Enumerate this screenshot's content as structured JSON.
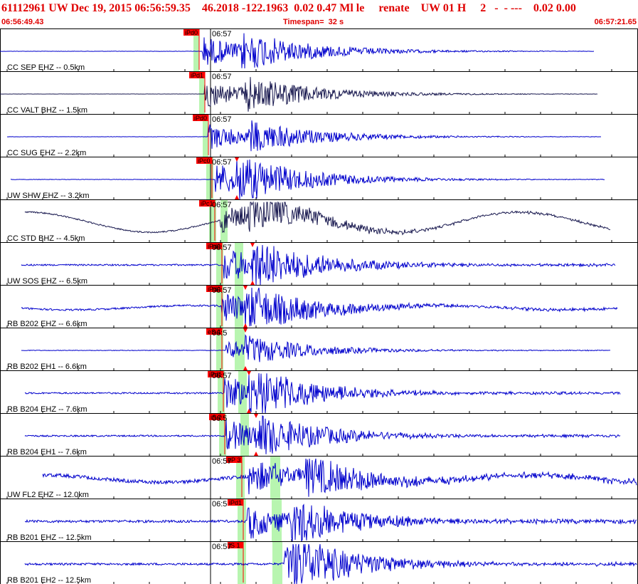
{
  "header": {
    "title": "61112961 UW Dec 19, 2015 06:56:59.35    46.2018 -122.1963  0.02 0.47 Ml le     renate    UW 01 H     2   -  - ---    0.02 0.00",
    "start_time": "06:56:49.43",
    "timespan": "Timespan=  32 s",
    "end_time": "06:57:21.65"
  },
  "colors": {
    "accent": "#e00000",
    "trace_blue": "#0000cc",
    "trace_dark": "#1a1a50",
    "pick_window": "#b8f5b0",
    "pick_flag": "#ff0000"
  },
  "traces": [
    {
      "label": "CC SEP EHZ -- 0.5km",
      "time_label": "06:57",
      "pick_label": "iPd0",
      "color": "blue",
      "noise": 0.4,
      "drift": 0,
      "onset": 285,
      "s_onset": 340,
      "end": 835,
      "amp": 22,
      "start": 0
    },
    {
      "label": "CC VALT BHZ -- 1.5km",
      "time_label": "06:57",
      "pick_label": "iPd1",
      "color": "dark",
      "noise": 0.3,
      "drift": 0,
      "onset": 288,
      "s_onset": 345,
      "end": 840,
      "amp": 20,
      "start": 0
    },
    {
      "label": "CC SUG EHZ -- 2.2km",
      "time_label": "06:57",
      "pick_label": "iPd0",
      "color": "blue",
      "noise": 0.4,
      "drift": 0,
      "onset": 293,
      "s_onset": 350,
      "end": 845,
      "amp": 18,
      "start": 10
    },
    {
      "label": "UW SHW EHZ -- 3.2km",
      "time_label": "06:57",
      "pick_label": "iPc0",
      "color": "blue",
      "noise": 0.6,
      "drift": 0,
      "onset": 303,
      "s_onset": 333,
      "end": 850,
      "amp": 24,
      "start": 15
    },
    {
      "label": "CC STD BHZ -- 4.5km",
      "time_label": "06:57",
      "pick_label": "iPc1",
      "color": "dark",
      "noise": 2.0,
      "drift": 14,
      "onset": 310,
      "s_onset": 350,
      "end": 858,
      "amp": 20,
      "start": 35
    },
    {
      "label": "UW SOS EHZ -- 6.5km",
      "time_label": "06:57",
      "pick_label": "iPd0",
      "color": "blue",
      "noise": 2.2,
      "drift": 0,
      "onset": 315,
      "s_onset": 355,
      "end": 865,
      "amp": 26,
      "start": 30
    },
    {
      "label": "RB B202 EHZ -- 6.6km",
      "time_label": "06:57",
      "pick_label": "iPd0",
      "color": "blue",
      "noise": 2.5,
      "drift": 3,
      "onset": 312,
      "s_onset": 345,
      "end": 868,
      "amp": 24,
      "start": 30
    },
    {
      "label": "RB B202 EH1 -- 6.6km",
      "time_label": "06:5",
      "pick_label": "eS 1",
      "color": "blue",
      "noise": 0.8,
      "drift": 0,
      "onset": 318,
      "s_onset": 345,
      "end": 858,
      "amp": 14,
      "start": 30
    },
    {
      "label": "RB B204 EHZ -- 7.6km",
      "time_label": "06:57",
      "pick_label": "iPd1",
      "color": "blue",
      "noise": 2.2,
      "drift": 0,
      "onset": 316,
      "s_onset": 350,
      "end": 872,
      "amp": 26,
      "start": 35
    },
    {
      "label": "RB B204 EH1 -- 7.6km",
      "time_label": "06:5",
      "pick_label": "iS 2",
      "color": "blue",
      "noise": 2.2,
      "drift": 0,
      "onset": 318,
      "s_onset": 360,
      "end": 872,
      "amp": 24,
      "start": 35
    },
    {
      "label": "UW FL2 EHZ -- 12.0km",
      "time_label": "06:57",
      "pick_label": "eP 3",
      "color": "blue",
      "noise": 5.0,
      "drift": 5,
      "onset": 350,
      "s_onset": 430,
      "end": 895,
      "amp": 26,
      "start": 60
    },
    {
      "label": "RB B201 EHZ -- 12.5km",
      "time_label": "06:5",
      "pick_label": "iPd1",
      "color": "blue",
      "noise": 3.5,
      "drift": 0,
      "onset": 348,
      "s_onset": 410,
      "end": 895,
      "amp": 26,
      "start": 35
    },
    {
      "label": "RB B201 EH2 -- 12.5km",
      "time_label": "06:57",
      "pick_label": "iS 1",
      "color": "blue",
      "noise": 3.0,
      "drift": 0,
      "onset": 400,
      "s_onset": 410,
      "end": 895,
      "amp": 26,
      "start": 35
    }
  ]
}
